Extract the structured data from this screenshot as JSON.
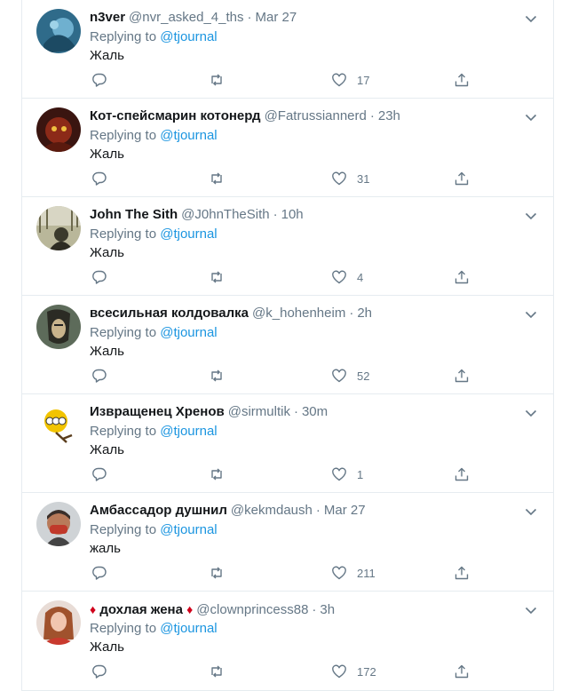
{
  "replying_label": "Replying to",
  "tweets": [
    {
      "name": "n3ver",
      "handle": "@nvr_asked_4_ths",
      "time": "Mar 27",
      "mention": "@tjournal",
      "text": "Жаль",
      "likes": "17",
      "avatar_color": "#2f6b8a"
    },
    {
      "name": "Кот-спейсмарин котонерд",
      "handle": "@Fatrussiannerd",
      "time": "23h",
      "mention": "@tjournal",
      "text": "Жаль",
      "likes": "31",
      "avatar_color": "#7a1f12"
    },
    {
      "name": "John The Sith",
      "handle": "@J0hnTheSith",
      "time": "10h",
      "mention": "@tjournal",
      "text": "Жаль",
      "likes": "4",
      "avatar_color": "#8a8a6a"
    },
    {
      "name": "всесильная колдовалка",
      "handle": "@k_hohenheim",
      "time": "2h",
      "mention": "@tjournal",
      "text": "Жаль",
      "likes": "52",
      "avatar_color": "#4d5a4a"
    },
    {
      "name": "Извращенец Хренов",
      "handle": "@sirmultik",
      "time": "30m",
      "mention": "@tjournal",
      "text": "Жаль",
      "likes": "1",
      "avatar_color": "#f2c400"
    },
    {
      "name": "Амбассадор душнил",
      "handle": "@kekmdaush",
      "time": "Mar 27",
      "mention": "@tjournal",
      "text": "жаль",
      "likes": "211",
      "avatar_color": "#c0392b"
    },
    {
      "name": "дохлая жена",
      "name_decor": "♦",
      "handle": "@clownprincess88",
      "time": "3h",
      "mention": "@tjournal",
      "text": "Жаль",
      "likes": "172",
      "avatar_color": "#c93a2e"
    }
  ],
  "icons": {
    "reply": "reply-icon",
    "retweet": "retweet-icon",
    "like": "heart-icon",
    "share": "share-icon",
    "more": "chevron-down-icon"
  },
  "colors": {
    "text": "#14171a",
    "secondary": "#657786",
    "link": "#1b95e0",
    "divider": "#e6ecf0",
    "diamond": "#d0021b"
  }
}
